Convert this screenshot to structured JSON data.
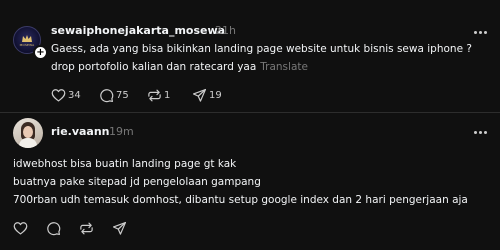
{
  "post1": {
    "username": "sewaiphonejakarta_mosewa",
    "time": "21h",
    "avatar_text": "MOSEWA",
    "line1": "Gaess, ada yang bisa bikinkan landing page website untuk bisnis sewa iphone ?",
    "line2": "drop portofolio kalian dan ratecard yaa",
    "translate": "Translate",
    "likes": "34",
    "replies": "75",
    "reposts": "1",
    "shares": "19"
  },
  "post2": {
    "username": "rie.vaann",
    "time": "19m",
    "line1": "idwebhost bisa buatin landing page gt kak",
    "line2": "buatnya pake sitepad jd pengelolaan gampang",
    "line3": "700rban udh temasuk domhost, dibantu setup google index dan 2 hari pengerjaan aja"
  },
  "icons": {
    "like": "heart-icon",
    "reply": "comment-icon",
    "repost": "repost-icon",
    "share": "send-icon",
    "more": "more-icon",
    "follow": "plus-icon"
  },
  "colors": {
    "background": "#101010",
    "text": "#f3f5f7",
    "muted": "#777777"
  }
}
